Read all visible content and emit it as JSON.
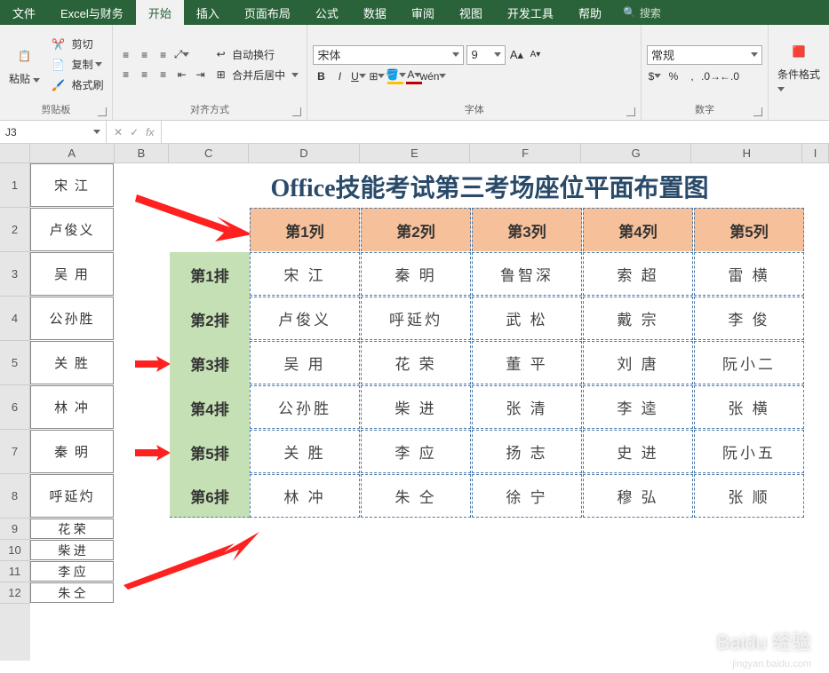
{
  "tabs": [
    "文件",
    "Excel与财务",
    "开始",
    "插入",
    "页面布局",
    "公式",
    "数据",
    "审阅",
    "视图",
    "开发工具",
    "帮助"
  ],
  "activeTab": "开始",
  "search": "搜索",
  "ribbon": {
    "clipboard": {
      "paste": "粘贴",
      "cut": "剪切",
      "copy": "复制",
      "format": "格式刷",
      "label": "剪贴板"
    },
    "align": {
      "wrap": "自动换行",
      "merge": "合并后居中",
      "label": "对齐方式"
    },
    "font": {
      "name": "宋体",
      "size": "9",
      "label": "字体"
    },
    "number": {
      "format": "常规",
      "label": "数字"
    },
    "styles": {
      "cond": "条件格式",
      "label": ""
    }
  },
  "namebox": "J3",
  "cols": [
    "A",
    "B",
    "C",
    "D",
    "E",
    "F",
    "G",
    "H",
    "I"
  ],
  "rows": [
    1,
    2,
    3,
    4,
    5,
    6,
    7,
    8,
    9,
    10,
    11,
    12
  ],
  "colA": [
    "宋 江",
    "卢俊义",
    "吴 用",
    "公孙胜",
    "关 胜",
    "林 冲",
    "秦 明",
    "呼延灼",
    "花 荣",
    "柴 进",
    "李 应",
    "朱 仝"
  ],
  "title": "Office技能考试第三考场座位平面布置图",
  "colHdrs": [
    "第1列",
    "第2列",
    "第3列",
    "第4列",
    "第5列"
  ],
  "rowHdrs": [
    "第1排",
    "第2排",
    "第3排",
    "第4排",
    "第5排",
    "第6排"
  ],
  "seat": [
    [
      "宋 江",
      "秦 明",
      "鲁智深",
      "索 超",
      "雷 横"
    ],
    [
      "卢俊义",
      "呼延灼",
      "武 松",
      "戴 宗",
      "李 俊"
    ],
    [
      "吴 用",
      "花 荣",
      "董 平",
      "刘 唐",
      "阮小二"
    ],
    [
      "公孙胜",
      "柴 进",
      "张 清",
      "李 逵",
      "张 横"
    ],
    [
      "关 胜",
      "李 应",
      "扬 志",
      "史 进",
      "阮小五"
    ],
    [
      "林 冲",
      "朱 仝",
      "徐 宁",
      "穆 弘",
      "张 顺"
    ]
  ],
  "watermark": "Baidu 经验",
  "watermark2": "jingyan.baidu.com"
}
